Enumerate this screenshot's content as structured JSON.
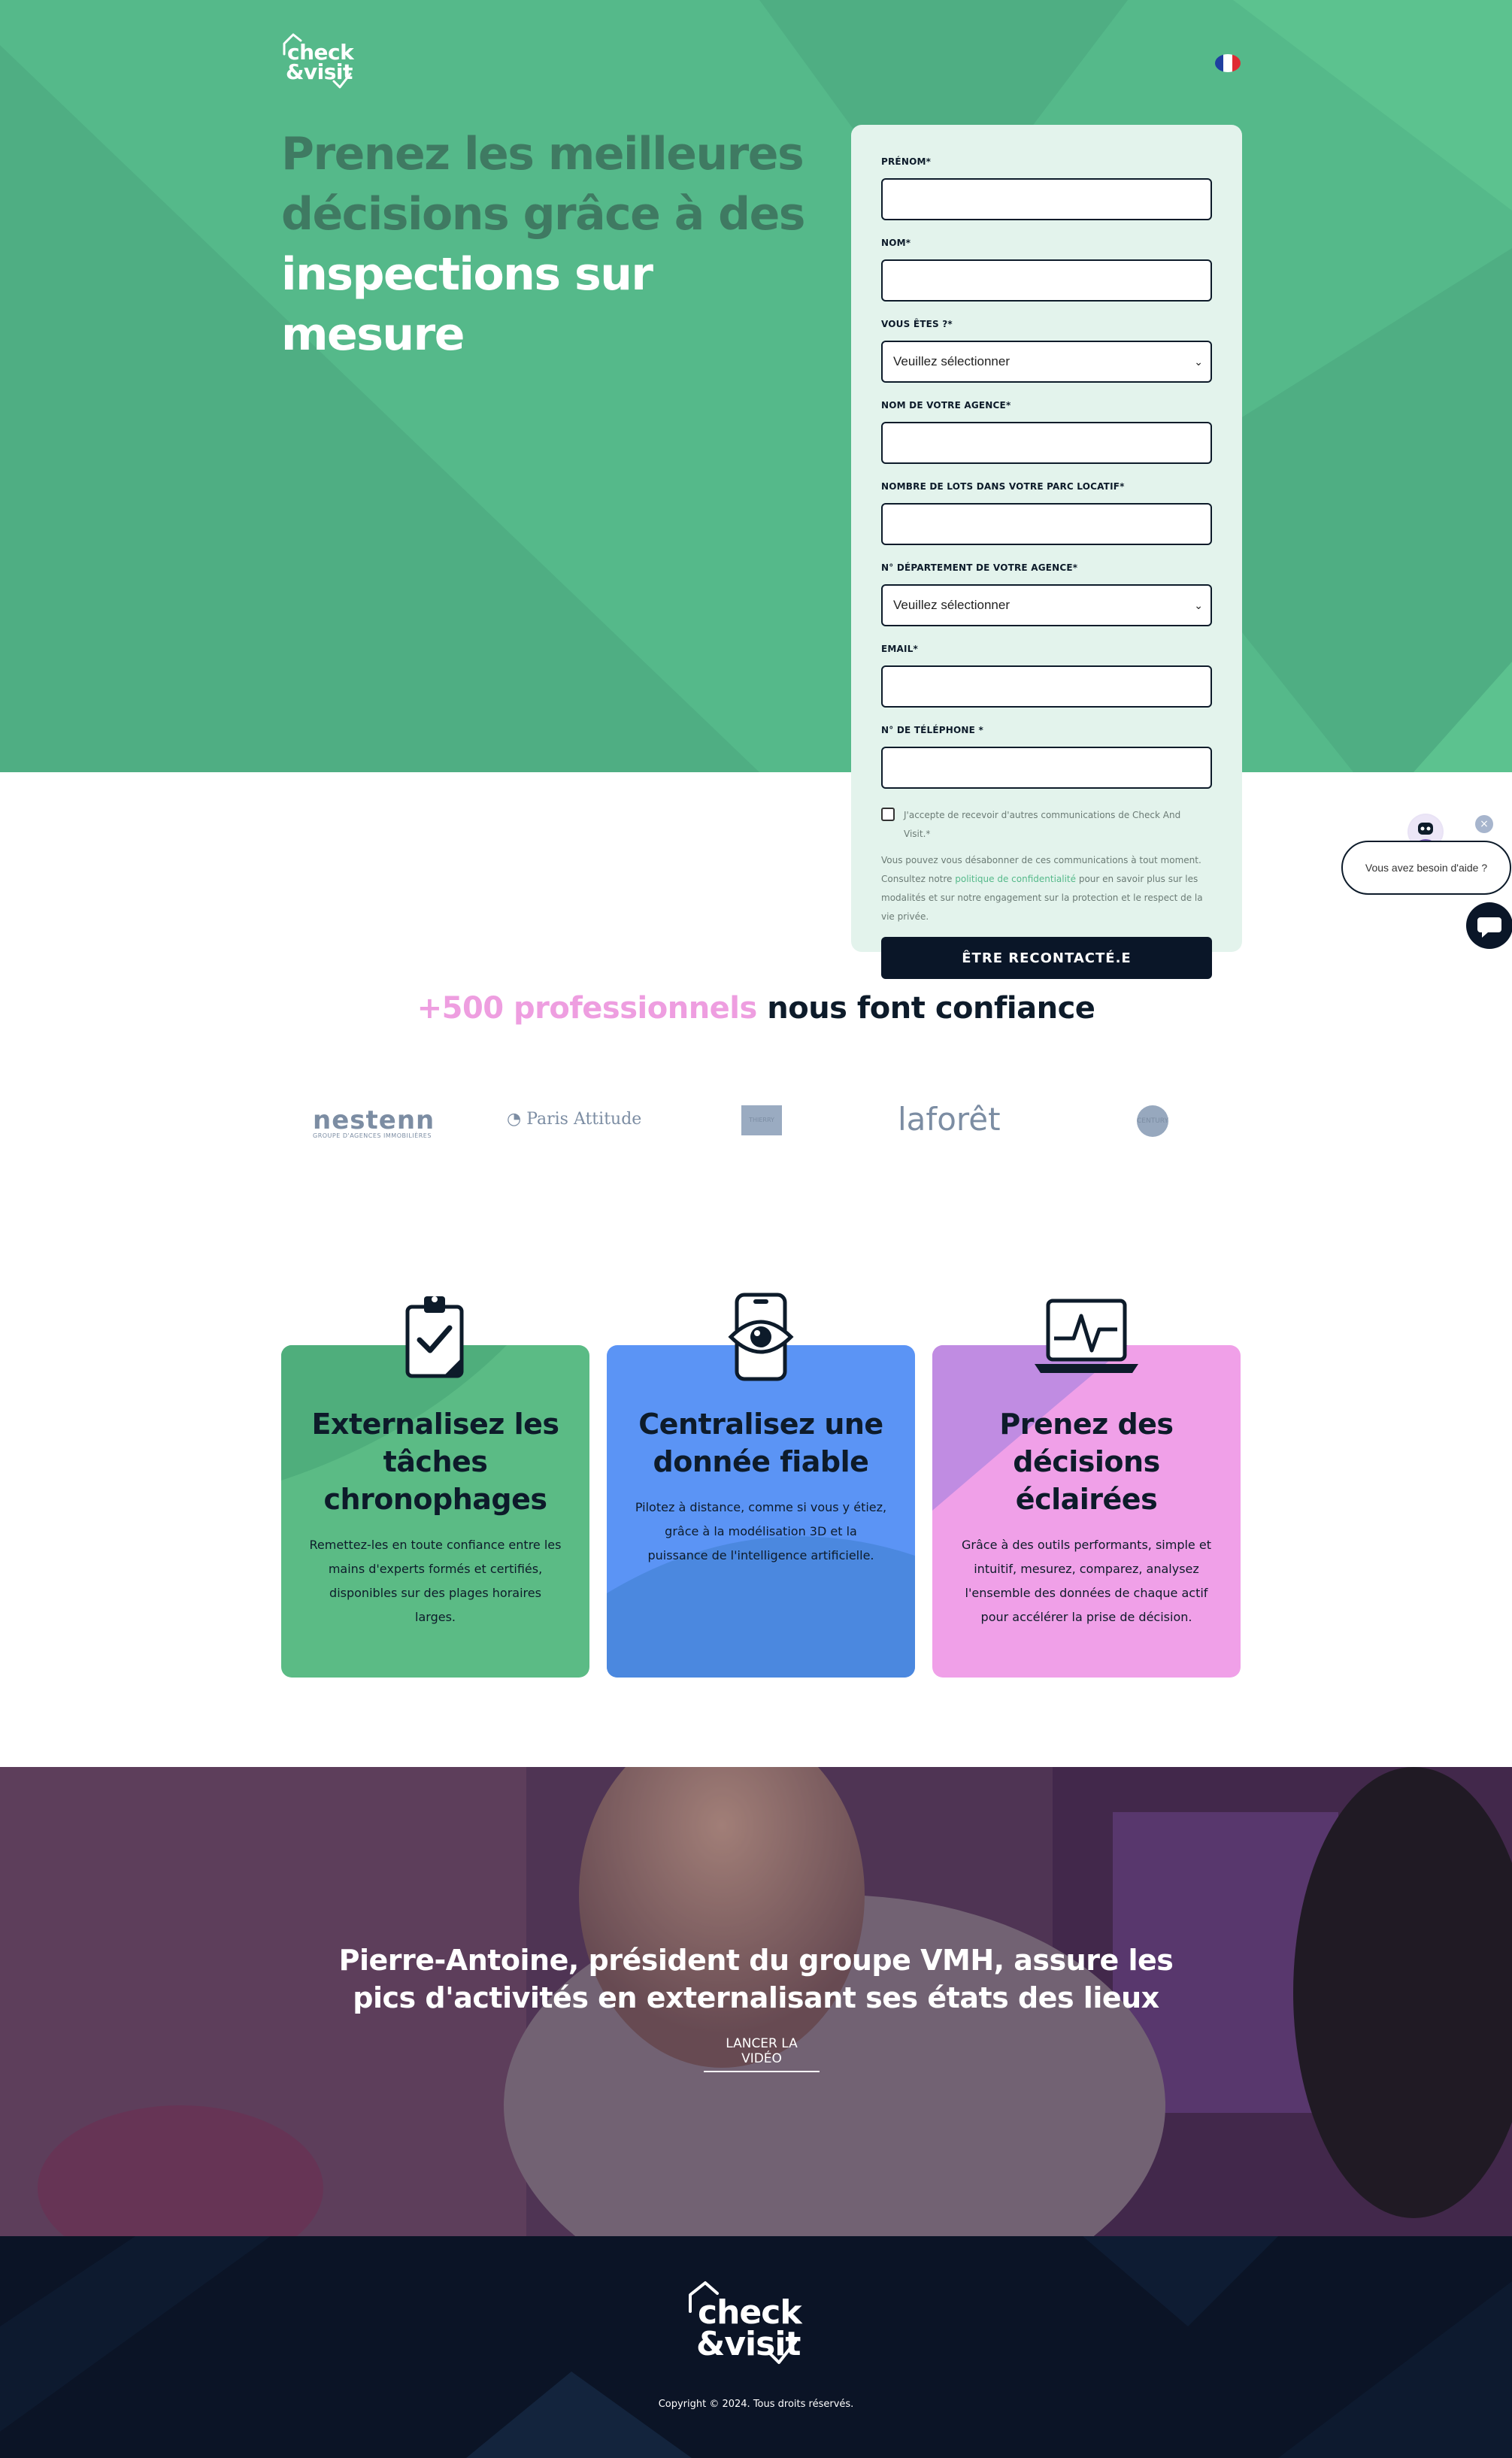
{
  "header": {
    "logo_line1": "check",
    "logo_line2": "&visit",
    "language_flag": "fr"
  },
  "hero": {
    "headline_dark_1": "Prenez les meilleures",
    "headline_dark_2": "décisions grâce à des",
    "headline_light_1": "inspections sur",
    "headline_light_2": "mesure"
  },
  "form": {
    "fields": [
      {
        "label": "PRÉNOM*",
        "type": "text",
        "value": ""
      },
      {
        "label": "NOM*",
        "type": "text",
        "value": ""
      },
      {
        "label": "VOUS ÊTES ?*",
        "type": "select",
        "value": "Veuillez sélectionner"
      },
      {
        "label": "NOM DE VOTRE AGENCE*",
        "type": "text",
        "value": ""
      },
      {
        "label": "NOMBRE DE LOTS DANS VOTRE PARC LOCATIF*",
        "type": "text",
        "value": ""
      },
      {
        "label": "N° DÉPARTEMENT DE VOTRE AGENCE*",
        "type": "select",
        "value": "Veuillez sélectionner"
      },
      {
        "label": "EMAIL*",
        "type": "text",
        "value": ""
      },
      {
        "label": "N° DE TÉLÉPHONE *",
        "type": "text",
        "value": ""
      }
    ],
    "consent_label": "J'accepte de recevoir d'autres communications de Check And Visit.*",
    "privacy_before": "Vous pouvez vous désabonner de ces communications à tout moment. Consultez notre ",
    "privacy_link": "politique de confidentialité",
    "privacy_after": " pour en savoir plus sur les modalités et sur notre engagement sur la protection et le respect de la vie privée.",
    "submit_label": "ÊTRE RECONTACTÉ.E"
  },
  "chat": {
    "bubble_text": "Vous avez besoin d'aide ?",
    "close_symbol": "×"
  },
  "trust": {
    "highlight": "+500 professionnels",
    "rest": " nous font confiance",
    "logos": {
      "nestenn": "nestenn",
      "nestenn_sub": "GROUPE D'AGENCES IMMOBILIÈRES",
      "paris_attitude": "Paris Attitude",
      "thierry": "THIERRY",
      "laforet": "laforêt",
      "century": "CENTURY"
    }
  },
  "features": [
    {
      "title": "Externalisez les tâches chronophages",
      "text": "Remettez-les en toute confiance entre les mains d'experts formés et certifiés, disponibles sur des plages horaires larges.",
      "icon": "clipboard-check-icon",
      "color": "#5bbb85"
    },
    {
      "title": "Centralisez une donnée fiable",
      "text": "Pilotez à distance, comme si vous y étiez, grâce à la modélisation 3D et la puissance de l'intelligence artificielle.",
      "icon": "phone-eye-icon",
      "color": "#5b94f5"
    },
    {
      "title": "Prenez des décisions éclairées",
      "text": "Grâce à des outils performants, simple et intuitif, mesurez, comparez, analysez l'ensemble des données de chaque actif pour accélérer la prise de décision.",
      "icon": "laptop-chart-icon",
      "color": "#f0a0e8"
    }
  ],
  "video": {
    "title_line1": "Pierre-Antoine, président du groupe VMH, assure les",
    "title_line2": "pics d'activités en externalisant ses états des lieux",
    "link_label": "LANCER LA VIDÉO"
  },
  "footer": {
    "logo_line1": "check",
    "logo_line2": "&visit",
    "copyright": "Copyright © 2024. Tous droits réservés."
  },
  "colors": {
    "brand_green": "#55b98a",
    "navy": "#0a1628",
    "pink": "#ee9ee0",
    "blue": "#5b94f5"
  }
}
